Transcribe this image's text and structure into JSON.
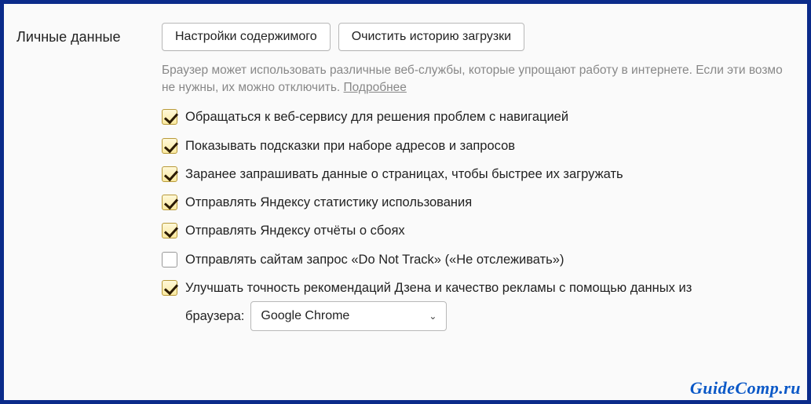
{
  "section_title": "Личные данные",
  "buttons": {
    "content_settings": "Настройки содержимого",
    "clear_history": "Очистить историю загрузки"
  },
  "hint": {
    "text_part1": "Браузер может использовать различные веб-службы, которые упрощают работу в интернете. Если эти возмо",
    "text_part2": "не нужны, их можно отключить. ",
    "link": "Подробнее"
  },
  "options": [
    {
      "checked": true,
      "label": "Обращаться к веб-сервису для решения проблем с навигацией"
    },
    {
      "checked": true,
      "label": "Показывать подсказки при наборе адресов и запросов"
    },
    {
      "checked": true,
      "label": "Заранее запрашивать данные о страницах, чтобы быстрее их загружать"
    },
    {
      "checked": true,
      "label": "Отправлять Яндексу статистику использования"
    },
    {
      "checked": true,
      "label": "Отправлять Яндексу отчёты о сбоях"
    },
    {
      "checked": false,
      "label": "Отправлять сайтам запрос «Do Not Track» («Не отслеживать»)"
    },
    {
      "checked": true,
      "label": "Улучшать точность рекомендаций Дзена и качество рекламы с помощью данных из "
    }
  ],
  "browser_select": {
    "prefix": "браузера:",
    "value": "Google Chrome"
  },
  "watermark": "GuideComp.ru"
}
